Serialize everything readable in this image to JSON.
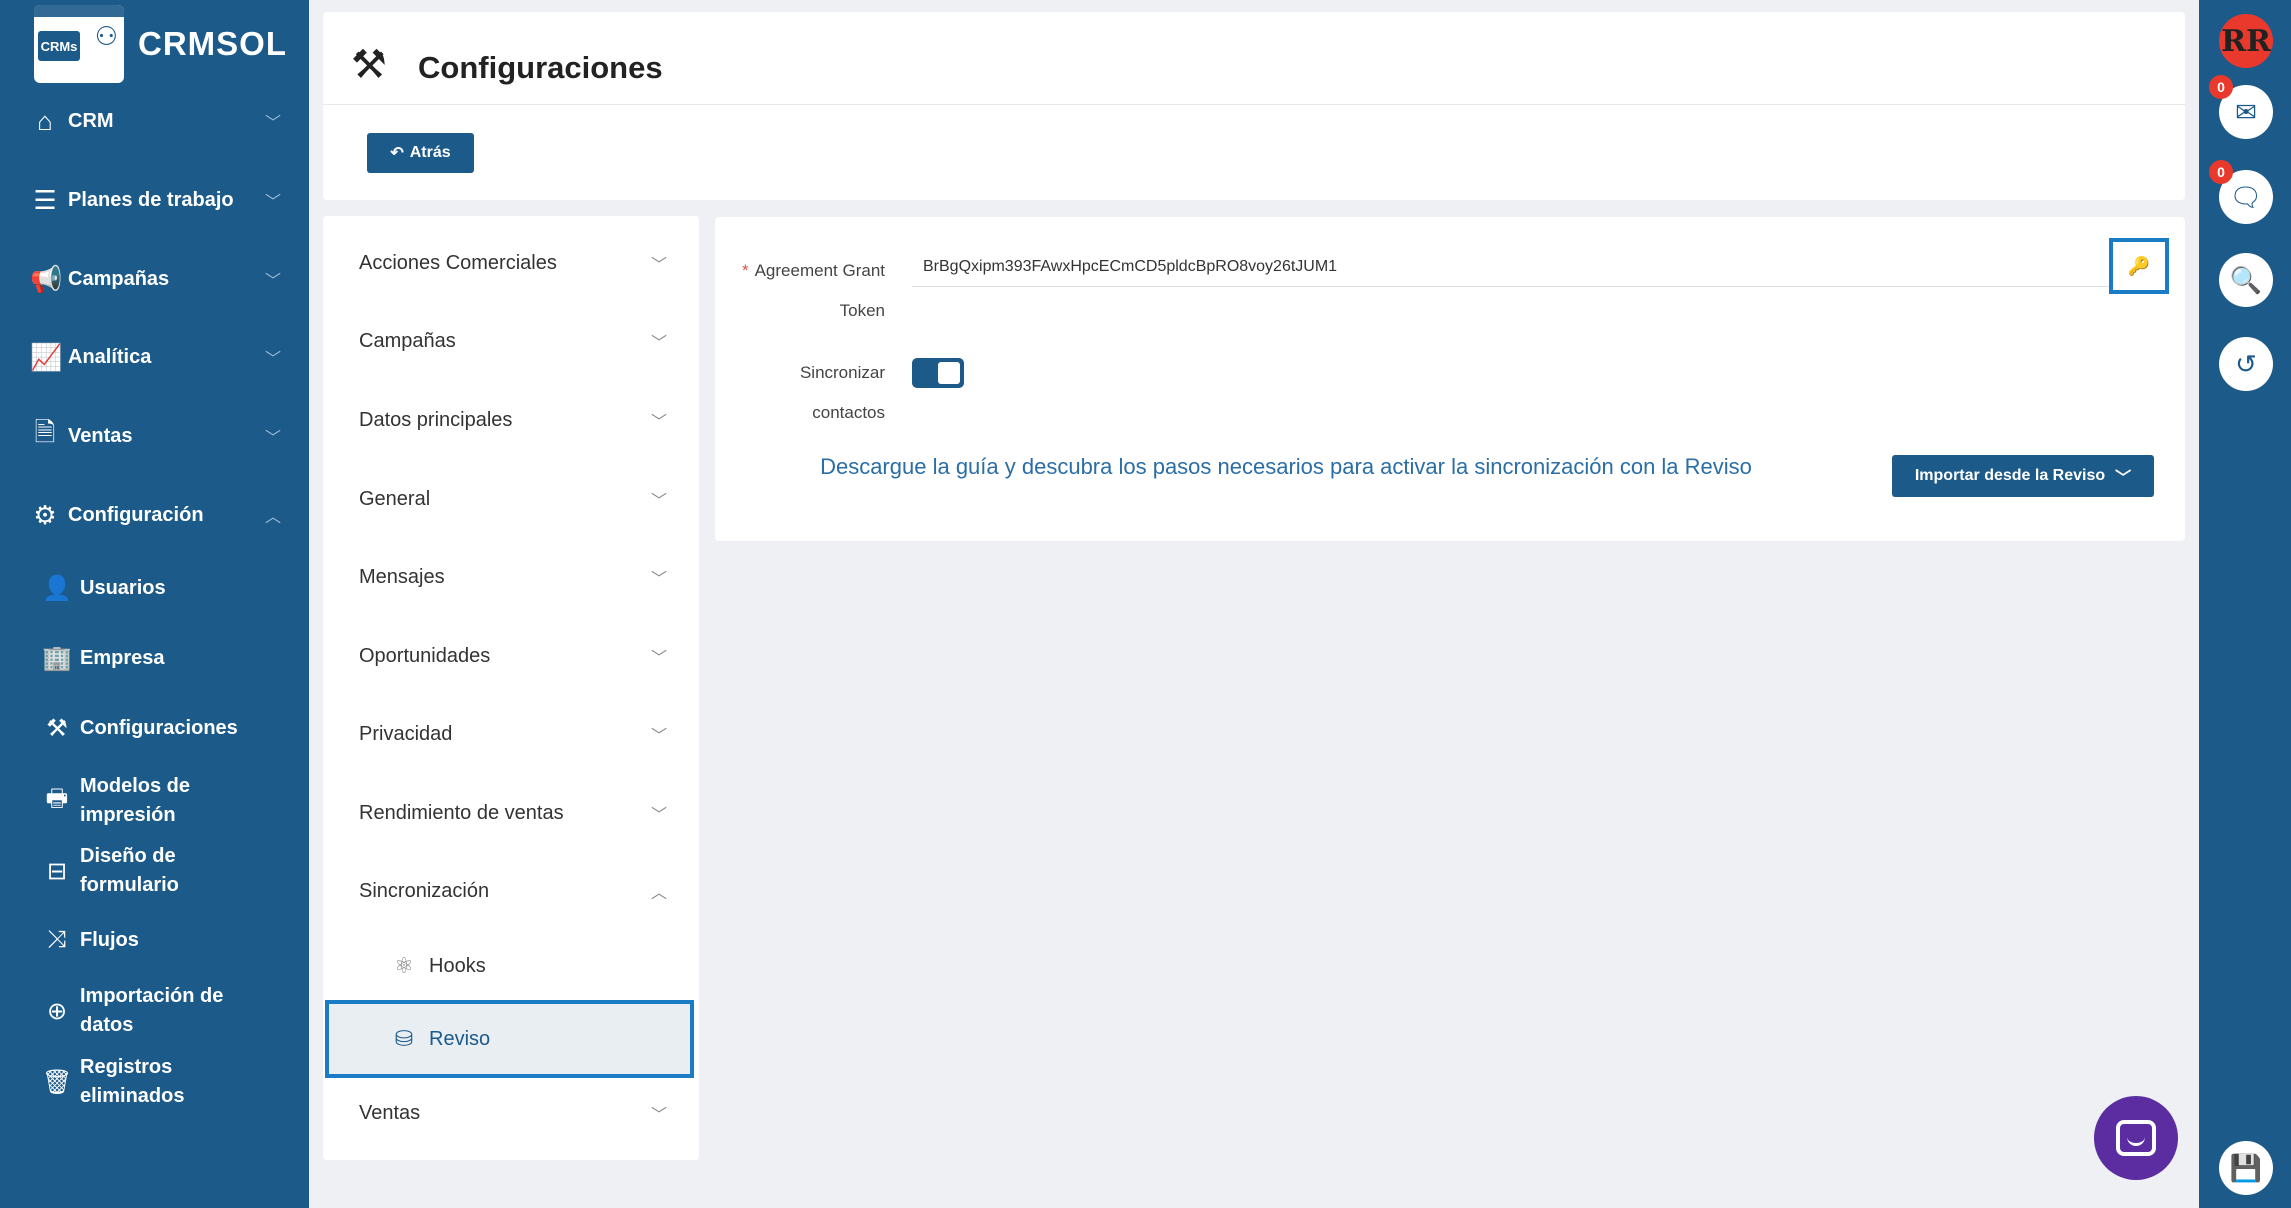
{
  "brand": {
    "name": "CRMSOL",
    "logo_text": "CRMs"
  },
  "sidebar": {
    "items": [
      {
        "label": "CRM",
        "icon": "home-icon"
      },
      {
        "label": "Planes de trabajo",
        "icon": "list-icon"
      },
      {
        "label": "Campañas",
        "icon": "megaphone-icon"
      },
      {
        "label": "Analítica",
        "icon": "chart-icon"
      },
      {
        "label": "Ventas",
        "icon": "document-icon"
      },
      {
        "label": "Configuración",
        "icon": "gear-icon"
      }
    ],
    "sub_items": [
      {
        "label": "Usuarios",
        "icon": "users-icon"
      },
      {
        "label": "Empresa",
        "icon": "building-icon"
      },
      {
        "label": "Configuraciones",
        "icon": "tools-icon"
      },
      {
        "label": "Modelos de\nimpresión",
        "icon": "printer-icon"
      },
      {
        "label": "Diseño de\nformulario",
        "icon": "form-icon"
      },
      {
        "label": "Flujos",
        "icon": "flow-icon"
      },
      {
        "label": "Importación de\ndatos",
        "icon": "import-icon"
      },
      {
        "label": "Registros\neliminados",
        "icon": "trash-icon"
      }
    ]
  },
  "header": {
    "title": "Configuraciones",
    "back_label": "Atrás"
  },
  "config_menu": {
    "sections": [
      "Acciones Comerciales",
      "Campañas",
      "Datos principales",
      "General",
      "Mensajes",
      "Oportunidades",
      "Privacidad",
      "Rendimiento de ventas",
      "Sincronización",
      "Ventas"
    ],
    "sync_children": [
      {
        "label": "Hooks",
        "icon": "atom-icon"
      },
      {
        "label": "Reviso",
        "icon": "database-icon",
        "active": true
      }
    ]
  },
  "form": {
    "token_label_1": "Agreement Grant",
    "token_label_2": "Token",
    "token_value": "BrBgQxipm393FAwxHpcECmCD5pldcBpRO8voy26tJUM1",
    "sync_label_1": "Sincronizar",
    "sync_label_2": "contactos",
    "sync_enabled": true,
    "guide_text": "Descargue la guía y descubra los pasos necesarios para activar la sincronización con la Reviso",
    "import_button": "Importar desde la Reviso"
  },
  "rail": {
    "avatar_initials": "RR",
    "mail_count": "0",
    "chat_count": "0"
  },
  "colors": {
    "primary": "#1c5a8a",
    "accent_border": "#1a7cc4",
    "badge": "#e8392c",
    "chat": "#5b2da0"
  }
}
